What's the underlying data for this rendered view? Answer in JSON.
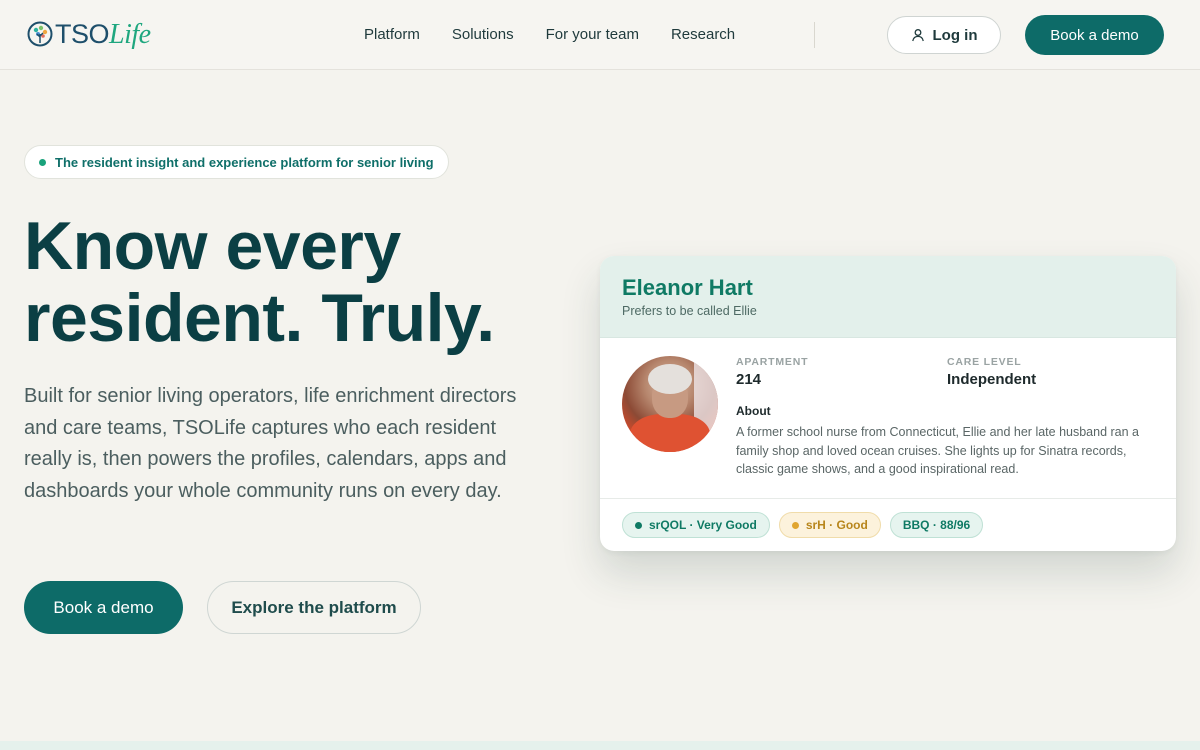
{
  "brand": {
    "logo_part1": "TSO",
    "logo_part2": "Life"
  },
  "nav": {
    "items": [
      {
        "label": "Platform"
      },
      {
        "label": "Solutions"
      },
      {
        "label": "For your team"
      },
      {
        "label": "Research"
      }
    ],
    "login_label": "Log in",
    "demo_label": "Book a demo"
  },
  "hero": {
    "tagline": "The resident insight and experience platform for senior living",
    "headline_line1": "Know every",
    "headline_line2": "resident. Truly.",
    "lead": "Built for senior living operators, life enrichment directors and care teams, TSOLife captures who each resident really is, then powers the profiles, calendars, apps and dashboards your whole community runs on every day.",
    "cta_primary": "Book a demo",
    "cta_secondary": "Explore the platform"
  },
  "resident_card": {
    "name": "Eleanor Hart",
    "preferred": "Prefers to be called Ellie",
    "apartment_label": "APARTMENT",
    "apartment_value": "214",
    "care_label": "CARE LEVEL",
    "care_value": "Independent",
    "about_label": "About",
    "about_text": "A former school nurse from Connecticut, Ellie and her late husband ran a family shop and loved ocean cruises. She lights up for Sinatra records, classic game shows, and a good inspirational read.",
    "badges": [
      {
        "text": "srQOL · Very Good",
        "style": "green"
      },
      {
        "text": "srH · Good",
        "style": "amber"
      },
      {
        "text": "BBQ · 88/96",
        "style": "teal"
      }
    ]
  },
  "colors": {
    "primary": "#0d6b68",
    "headline": "#0b3f44",
    "accent_green": "#19a27b",
    "background": "#f4f3ee"
  }
}
